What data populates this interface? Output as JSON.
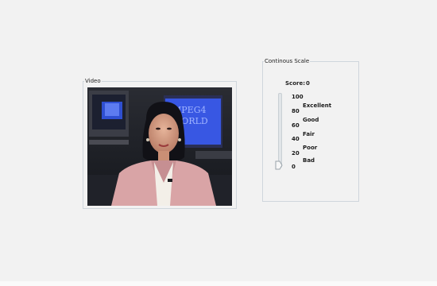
{
  "video_panel": {
    "title": "Video",
    "content": "News presenter video frame",
    "background_sign": "MPEG4\nWORLD"
  },
  "scale_panel": {
    "title": "Continous Scale",
    "score_label": "Score:",
    "score_value": "0",
    "ticks": [
      "100",
      "80",
      "60",
      "40",
      "20",
      "0"
    ],
    "quality_labels": [
      "Excellent",
      "Good",
      "Fair",
      "Poor",
      "Bad"
    ],
    "slider_value": 0
  }
}
